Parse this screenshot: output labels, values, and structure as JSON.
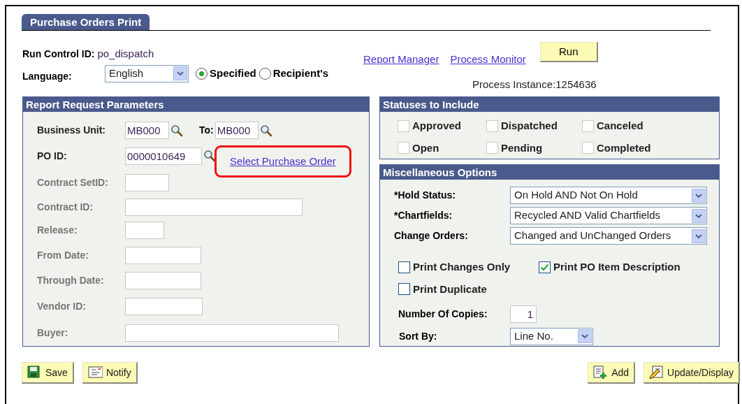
{
  "tab": {
    "label": "Purchase Orders Print",
    "selected": true
  },
  "run_control": {
    "label": "Run Control ID:",
    "value": "po_dispatch"
  },
  "language": {
    "label": "Language:",
    "value": "English",
    "options": [
      {
        "label": "Specified",
        "selected": true
      },
      {
        "label": "Recipient's",
        "selected": false
      }
    ]
  },
  "links": [
    "Report Manager",
    "Process Monitor"
  ],
  "run_button": "Run",
  "process_instance": "Process Instance:1254636",
  "report_request": {
    "title": "Report Request Parameters",
    "fields": [
      {
        "kind": "range",
        "label": "Business Unit:",
        "value": "MB000",
        "to_label": "To:",
        "to_value": "MB000",
        "disabled": false
      },
      {
        "kind": "lookup",
        "label": "PO ID:",
        "value": "0000010649",
        "link": "Select Purchase Order",
        "highlighted": true,
        "disabled": false
      },
      {
        "kind": "text",
        "label": "Contract SetID:",
        "disabled": true
      },
      {
        "kind": "text",
        "label": "Contract ID:",
        "disabled": true
      },
      {
        "kind": "text",
        "label": "Release:",
        "disabled": true
      },
      {
        "kind": "text",
        "label": "From Date:",
        "disabled": true
      },
      {
        "kind": "text",
        "label": "Through Date:",
        "disabled": true
      },
      {
        "kind": "text",
        "label": "Vendor ID:",
        "disabled": true
      },
      {
        "kind": "text",
        "label": "Buyer:",
        "disabled": true
      }
    ]
  },
  "statuses": {
    "title": "Statuses to Include",
    "items": [
      {
        "label": "Approved",
        "checked": false
      },
      {
        "label": "Dispatched",
        "checked": false
      },
      {
        "label": "Canceled",
        "checked": false
      },
      {
        "label": "Open",
        "checked": false
      },
      {
        "label": "Pending",
        "checked": false
      },
      {
        "label": "Completed",
        "checked": false
      }
    ]
  },
  "misc": {
    "title": "Miscellaneous Options",
    "selects": [
      {
        "label": "*Hold Status:",
        "value": "On Hold AND Not On Hold"
      },
      {
        "label": "*Chartfields:",
        "value": "Recycled AND Valid Chartfields"
      },
      {
        "label": "Change Orders:",
        "value": "Changed and UnChanged Orders"
      }
    ],
    "checkboxes": [
      {
        "label": "Print Changes Only",
        "checked": false
      },
      {
        "label": "Print PO Item Description",
        "checked": true
      },
      {
        "label": "Print Duplicate",
        "checked": false
      }
    ],
    "copies": {
      "label": "Number Of Copies:",
      "value": "1"
    },
    "sort_by": {
      "label": "Sort By:",
      "value": "Line No."
    }
  },
  "buttons_left": [
    {
      "kind": "save",
      "label": "Save"
    },
    {
      "kind": "notify",
      "label": "Notify"
    }
  ],
  "buttons_right": [
    {
      "kind": "add",
      "label": "Add"
    },
    {
      "kind": "update",
      "label": "Update/Display"
    }
  ]
}
